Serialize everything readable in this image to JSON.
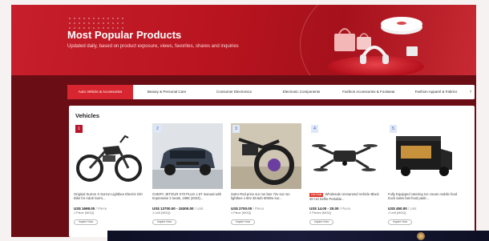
{
  "hero": {
    "title": "Most Popular Products",
    "subtitle": "Updated daily, based on product exposure, views, favorites, shares and inquiries"
  },
  "tabs": [
    {
      "label": "Auto Vehicle & Accessories",
      "active": true
    },
    {
      "label": "Beauty & Personal Care",
      "active": false
    },
    {
      "label": "Consumer Electronics",
      "active": false
    },
    {
      "label": "Electronic Components",
      "active": false
    },
    {
      "label": "Fashion Accessories & Footwear",
      "active": false
    },
    {
      "label": "Fashion Apparel & Fabrics",
      "active": false
    }
  ],
  "section": {
    "title": "Vehicles"
  },
  "products": [
    {
      "rank": "1",
      "desc": "Original Surron X Surron Lightbee Electric Dirt Bike for Adult Surro...",
      "price": "US$ 1698.00",
      "unit": "/ Piece",
      "moq": "1 Piece (MOQ)",
      "inquire": "Inquire Now"
    },
    {
      "rank": "2",
      "desc": "CHERY JETOUR X70 PLUS 1.5T manual with Impressive 2 seats, 1996 (2023)...",
      "price": "US$ 13700.00 - 15300.00",
      "unit": "/ Unit",
      "moq": "1 Unit (MOQ)",
      "inquire": "Inquire Now"
    },
    {
      "rank": "3",
      "desc": "Sutro Red price sur ron bee 72v sur ron lightbee x 60v 38.5ah 6000w sur...",
      "price": "US$ 2700.00",
      "unit": "/ Piece",
      "moq": "1 Piece (MOQ)",
      "inquire": "Inquire Now"
    },
    {
      "rank": "4",
      "badge": "Hot Sale",
      "desc": "Wholesale Unmanned Vehicle Black 4K Hd Selfie Portable...",
      "price": "US$ 14.00 - 20.00",
      "unit": "/ Piece",
      "moq": "2 Pieces (MOQ)",
      "inquire": "Inquire Now"
    },
    {
      "rank": "5",
      "desc": "Fully Equipped catering Ice cream mobile food truck sales fast food pastr...",
      "price": "US$ 450.00",
      "unit": "/ Unit",
      "moq": "1 Unit (MOQ)",
      "inquire": "Inquire Now"
    }
  ],
  "colors": {
    "brand_red": "#d7262f",
    "dark_band": "#6a0d14"
  }
}
